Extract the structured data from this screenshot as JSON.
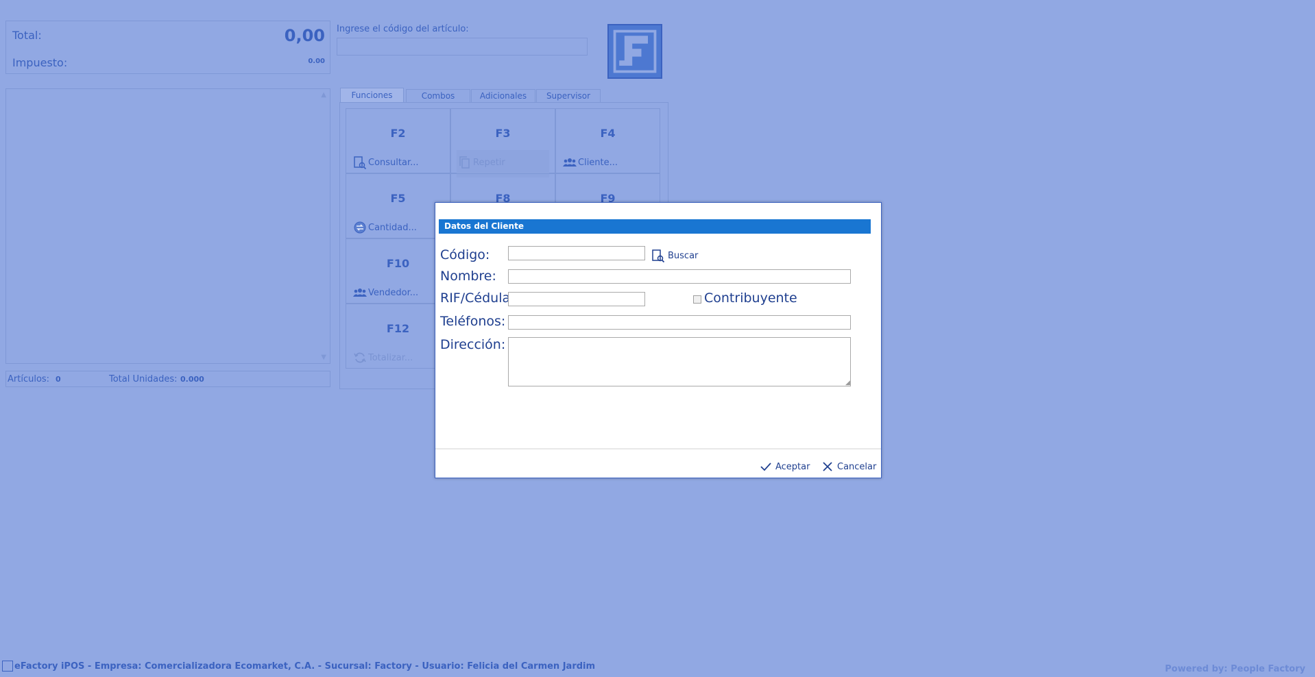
{
  "totals": {
    "total_label": "Total:",
    "total_value": "0,00",
    "tax_label": "Impuesto:",
    "tax_value": "0.00"
  },
  "article_code": {
    "label": "Ingrese el código del artículo:",
    "value": ""
  },
  "counts": {
    "articles_label": "Artículos:",
    "articles_value": "0",
    "units_label": "Total Unidades:",
    "units_value": "0.000"
  },
  "tabs": [
    "Funciones",
    "Combos",
    "Adicionales",
    "Supervisor"
  ],
  "functions": [
    {
      "key": "F2",
      "label": "Consultar...",
      "icon": "search-doc-icon"
    },
    {
      "key": "F3",
      "label": "Repetir",
      "icon": "copy-icon"
    },
    {
      "key": "F4",
      "label": "Cliente...",
      "icon": "users-icon"
    },
    {
      "key": "F5",
      "label": "Cantidad...",
      "icon": "quantity-icon"
    },
    {
      "key": "F8",
      "label": "",
      "icon": ""
    },
    {
      "key": "F9",
      "label": "",
      "icon": ""
    },
    {
      "key": "F10",
      "label": "Vendedor...",
      "icon": "users-icon"
    },
    {
      "key": "F12",
      "label": "Totalizar...",
      "icon": "refresh-icon"
    }
  ],
  "modal": {
    "title": "Datos del Cliente",
    "codigo_label": "Código:",
    "codigo_value": "",
    "buscar_label": "Buscar",
    "nombre_label": "Nombre:",
    "nombre_value": "",
    "rif_label": "RIF/Cédula:",
    "rif_value": "",
    "contribuyente_label": "Contribuyente",
    "contribuyente_checked": false,
    "telefonos_label": "Teléfonos:",
    "telefonos_value": "",
    "direccion_label": "Dirección:",
    "direccion_value": "",
    "accept_label": "Aceptar",
    "cancel_label": "Cancelar"
  },
  "status_bar": "eFactory iPOS - Empresa: Comercializadora Ecomarket, C.A. - Sucursal: Factory - Usuario: Felicia del Carmen Jardim",
  "powered_by": "Powered by: People Factory",
  "colors": {
    "background": "#91a8e3",
    "accent": "#3b62c0",
    "modal_header": "#1976d2"
  }
}
